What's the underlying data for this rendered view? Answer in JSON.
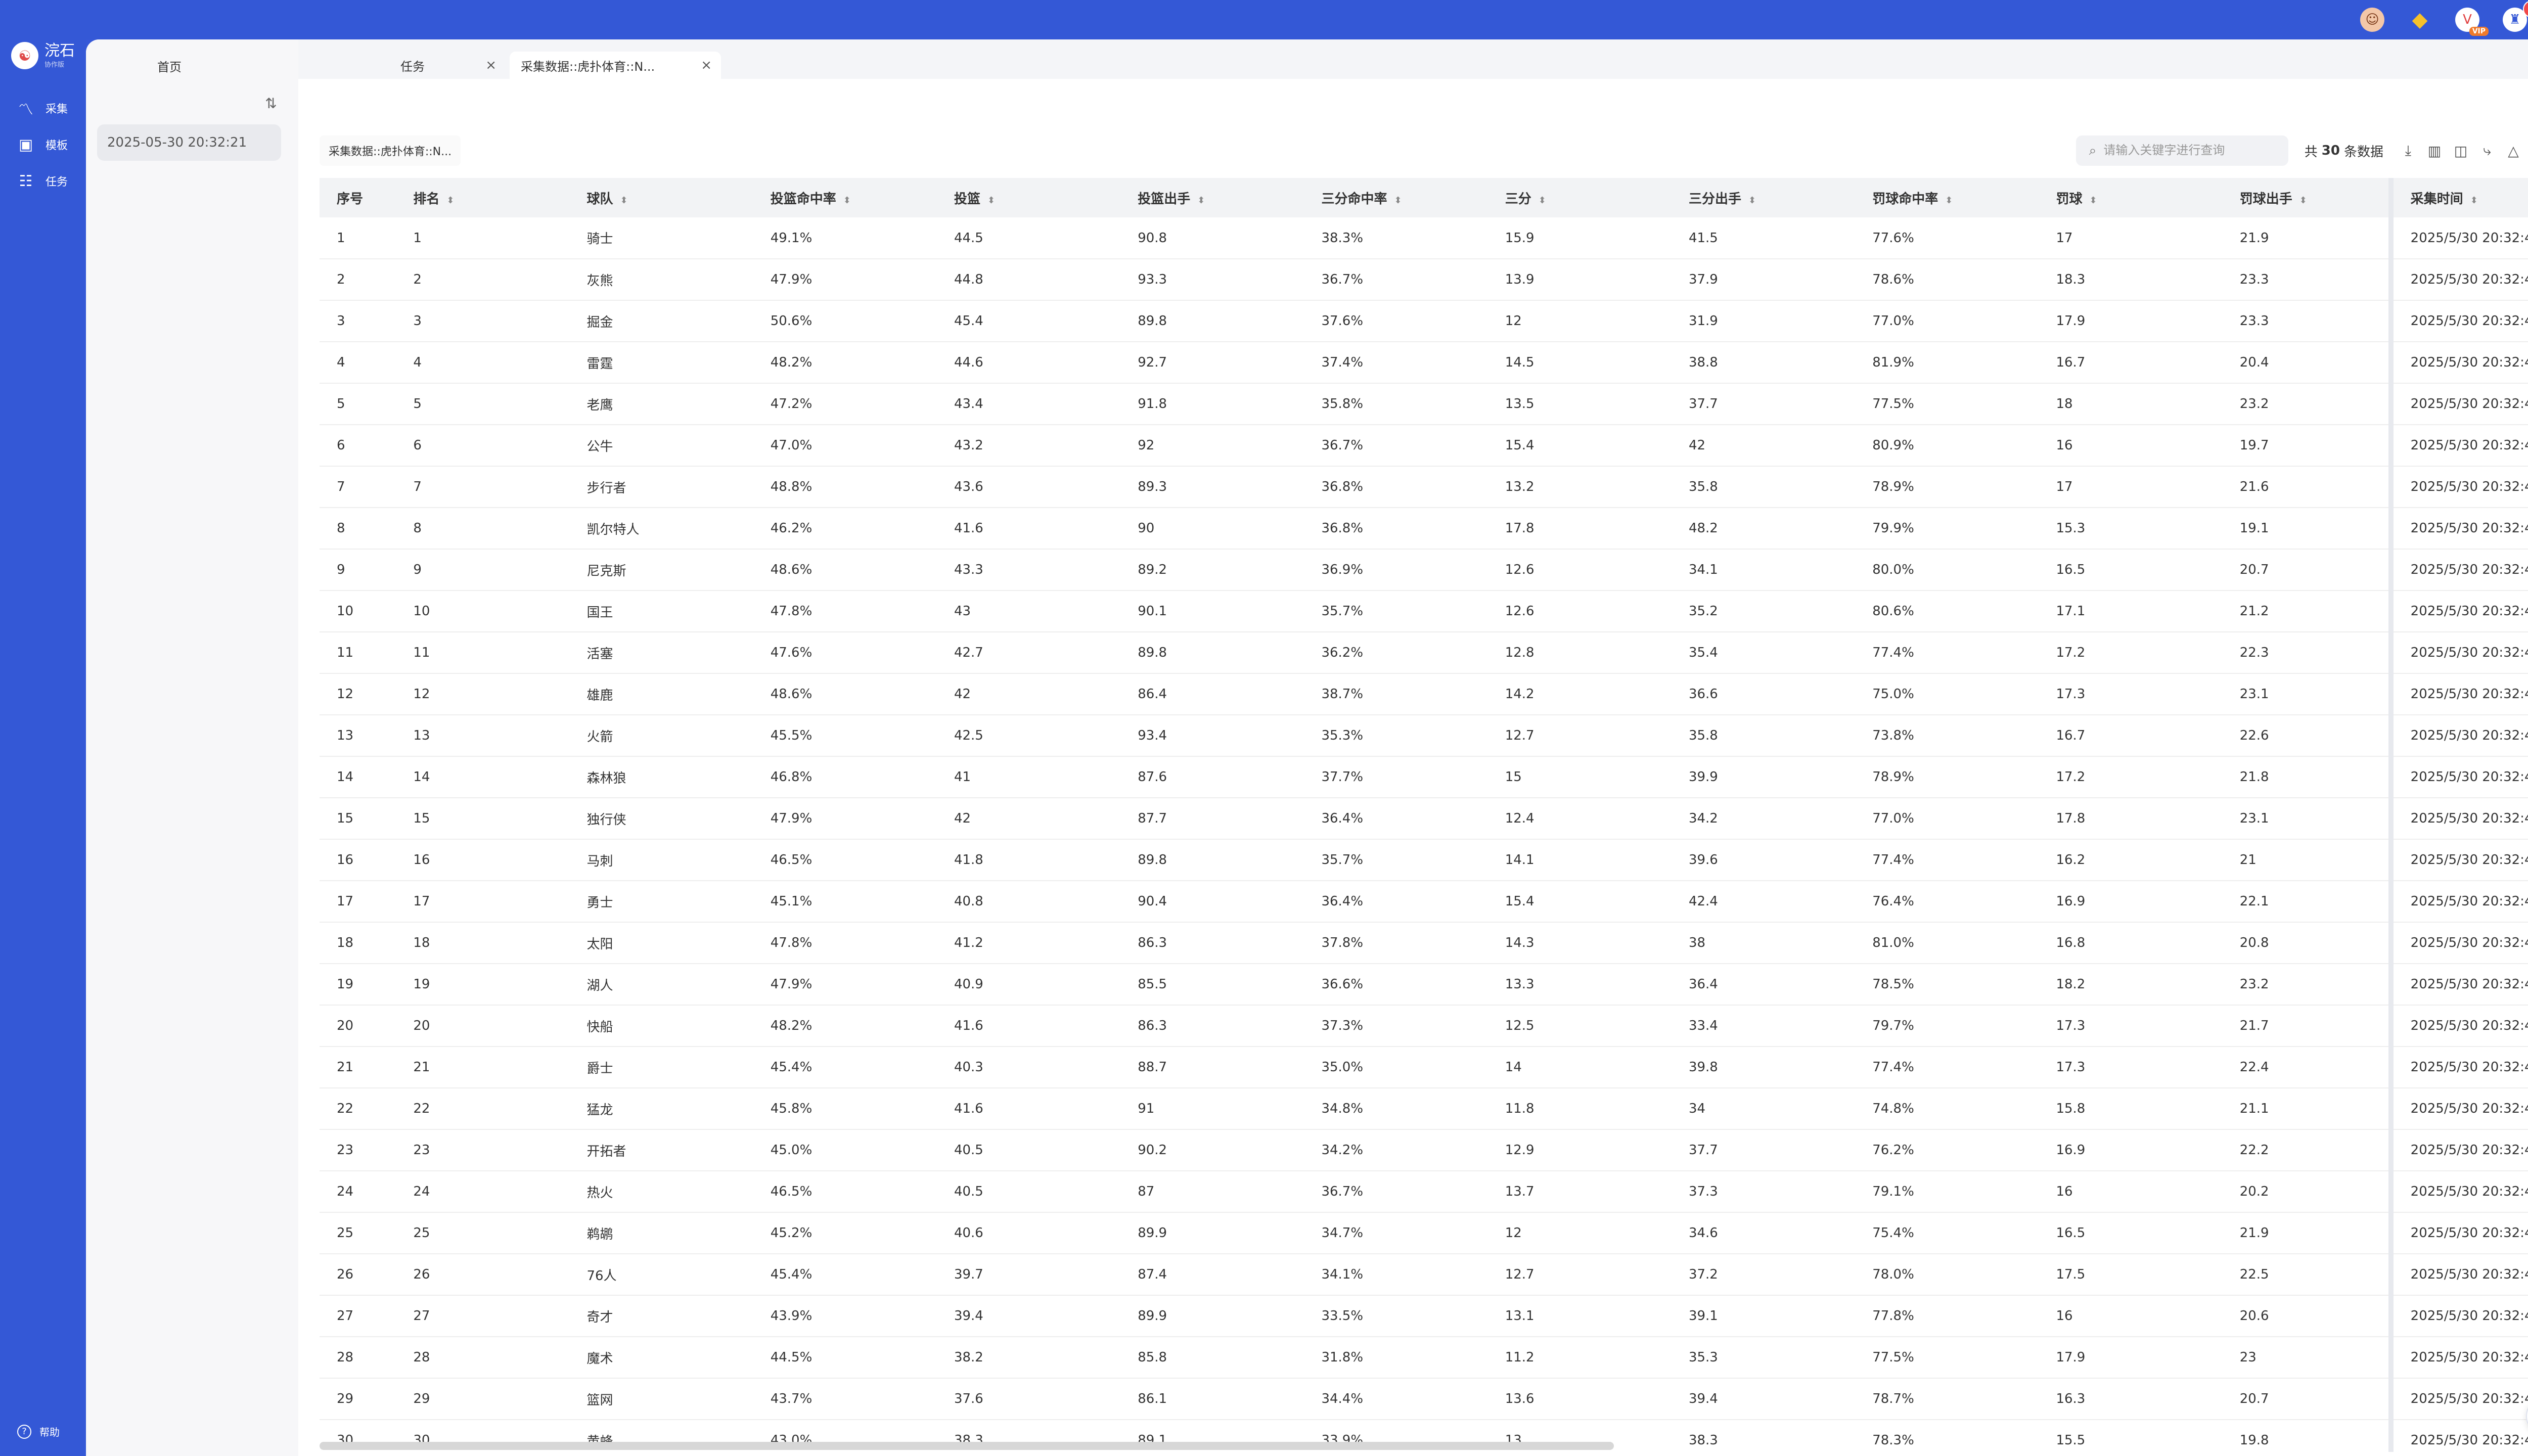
{
  "brand": {
    "name": "浣石",
    "sub": "协作版",
    "logo_icon": "☯"
  },
  "top_icons": [
    {
      "name": "user-avatar-icon",
      "symbol": "☺",
      "badge": ""
    },
    {
      "name": "diamond-icon",
      "symbol": "◆",
      "badge": ""
    },
    {
      "name": "vip-icon",
      "symbol": "V",
      "badge": "VIP"
    },
    {
      "name": "notification-icon",
      "symbol": "♜",
      "badge": "1"
    },
    {
      "name": "settings-icon",
      "symbol": "⚙",
      "badge": ""
    }
  ],
  "nav": [
    {
      "key": "collect",
      "label": "采集",
      "icon": "chart-line-icon",
      "symbol": "〽"
    },
    {
      "key": "templates",
      "label": "模板",
      "icon": "template-icon",
      "symbol": "▣"
    },
    {
      "key": "tasks",
      "label": "任务",
      "icon": "task-icon",
      "symbol": "☷"
    }
  ],
  "help": {
    "label": "帮助",
    "symbol": "?"
  },
  "home_tab": "首页",
  "tabs": [
    {
      "label": "任务",
      "close": "×"
    },
    {
      "label": "采集数据::虎扑体育::N...",
      "close": "×"
    }
  ],
  "panel": {
    "sort_icon": "⇅",
    "date": "2025-05-30 20:32:21"
  },
  "view_chip": "采集数据::虎扑体育::N...",
  "search": {
    "placeholder": "请输入关键字进行查询",
    "icon": "⌕"
  },
  "total": {
    "prefix": "共",
    "count": "30",
    "suffix": "条数据"
  },
  "toolbar_icons": [
    {
      "name": "download-icon",
      "symbol": "⤓"
    },
    {
      "name": "bar-chart-icon",
      "symbol": "▥"
    },
    {
      "name": "image-icon",
      "symbol": "◫"
    },
    {
      "name": "share-icon",
      "symbol": "⤷"
    },
    {
      "name": "warning-icon",
      "symbol": "△"
    },
    {
      "name": "save-icon",
      "symbol": "⛶"
    },
    {
      "name": "zoom-icon",
      "symbol": "⌕"
    }
  ],
  "table": {
    "columns": [
      "序号",
      "排名",
      "球队",
      "投篮命中率",
      "投篮",
      "投篮出手",
      "三分命中率",
      "三分",
      "三分出手",
      "罚球命中率",
      "罚球",
      "罚球出手",
      "采集时间"
    ],
    "rows": [
      [
        "1",
        "1",
        "骑士",
        "49.1%",
        "44.5",
        "90.8",
        "38.3%",
        "15.9",
        "41.5",
        "77.6%",
        "17",
        "21.9",
        "2025/5/30 20:32:44"
      ],
      [
        "2",
        "2",
        "灰熊",
        "47.9%",
        "44.8",
        "93.3",
        "36.7%",
        "13.9",
        "37.9",
        "78.6%",
        "18.3",
        "23.3",
        "2025/5/30 20:32:44"
      ],
      [
        "3",
        "3",
        "掘金",
        "50.6%",
        "45.4",
        "89.8",
        "37.6%",
        "12",
        "31.9",
        "77.0%",
        "17.9",
        "23.3",
        "2025/5/30 20:32:44"
      ],
      [
        "4",
        "4",
        "雷霆",
        "48.2%",
        "44.6",
        "92.7",
        "37.4%",
        "14.5",
        "38.8",
        "81.9%",
        "16.7",
        "20.4",
        "2025/5/30 20:32:44"
      ],
      [
        "5",
        "5",
        "老鹰",
        "47.2%",
        "43.4",
        "91.8",
        "35.8%",
        "13.5",
        "37.7",
        "77.5%",
        "18",
        "23.2",
        "2025/5/30 20:32:44"
      ],
      [
        "6",
        "6",
        "公牛",
        "47.0%",
        "43.2",
        "92",
        "36.7%",
        "15.4",
        "42",
        "80.9%",
        "16",
        "19.7",
        "2025/5/30 20:32:44"
      ],
      [
        "7",
        "7",
        "步行者",
        "48.8%",
        "43.6",
        "89.3",
        "36.8%",
        "13.2",
        "35.8",
        "78.9%",
        "17",
        "21.6",
        "2025/5/30 20:32:44"
      ],
      [
        "8",
        "8",
        "凯尔特人",
        "46.2%",
        "41.6",
        "90",
        "36.8%",
        "17.8",
        "48.2",
        "79.9%",
        "15.3",
        "19.1",
        "2025/5/30 20:32:44"
      ],
      [
        "9",
        "9",
        "尼克斯",
        "48.6%",
        "43.3",
        "89.2",
        "36.9%",
        "12.6",
        "34.1",
        "80.0%",
        "16.5",
        "20.7",
        "2025/5/30 20:32:44"
      ],
      [
        "10",
        "10",
        "国王",
        "47.8%",
        "43",
        "90.1",
        "35.7%",
        "12.6",
        "35.2",
        "80.6%",
        "17.1",
        "21.2",
        "2025/5/30 20:32:44"
      ],
      [
        "11",
        "11",
        "活塞",
        "47.6%",
        "42.7",
        "89.8",
        "36.2%",
        "12.8",
        "35.4",
        "77.4%",
        "17.2",
        "22.3",
        "2025/5/30 20:32:44"
      ],
      [
        "12",
        "12",
        "雄鹿",
        "48.6%",
        "42",
        "86.4",
        "38.7%",
        "14.2",
        "36.6",
        "75.0%",
        "17.3",
        "23.1",
        "2025/5/30 20:32:44"
      ],
      [
        "13",
        "13",
        "火箭",
        "45.5%",
        "42.5",
        "93.4",
        "35.3%",
        "12.7",
        "35.8",
        "73.8%",
        "16.7",
        "22.6",
        "2025/5/30 20:32:44"
      ],
      [
        "14",
        "14",
        "森林狼",
        "46.8%",
        "41",
        "87.6",
        "37.7%",
        "15",
        "39.9",
        "78.9%",
        "17.2",
        "21.8",
        "2025/5/30 20:32:44"
      ],
      [
        "15",
        "15",
        "独行侠",
        "47.9%",
        "42",
        "87.7",
        "36.4%",
        "12.4",
        "34.2",
        "77.0%",
        "17.8",
        "23.1",
        "2025/5/30 20:32:44"
      ],
      [
        "16",
        "16",
        "马刺",
        "46.5%",
        "41.8",
        "89.8",
        "35.7%",
        "14.1",
        "39.6",
        "77.4%",
        "16.2",
        "21",
        "2025/5/30 20:32:44"
      ],
      [
        "17",
        "17",
        "勇士",
        "45.1%",
        "40.8",
        "90.4",
        "36.4%",
        "15.4",
        "42.4",
        "76.4%",
        "16.9",
        "22.1",
        "2025/5/30 20:32:44"
      ],
      [
        "18",
        "18",
        "太阳",
        "47.8%",
        "41.2",
        "86.3",
        "37.8%",
        "14.3",
        "38",
        "81.0%",
        "16.8",
        "20.8",
        "2025/5/30 20:32:44"
      ],
      [
        "19",
        "19",
        "湖人",
        "47.9%",
        "40.9",
        "85.5",
        "36.6%",
        "13.3",
        "36.4",
        "78.5%",
        "18.2",
        "23.2",
        "2025/5/30 20:32:44"
      ],
      [
        "20",
        "20",
        "快船",
        "48.2%",
        "41.6",
        "86.3",
        "37.3%",
        "12.5",
        "33.4",
        "79.7%",
        "17.3",
        "21.7",
        "2025/5/30 20:32:44"
      ],
      [
        "21",
        "21",
        "爵士",
        "45.4%",
        "40.3",
        "88.7",
        "35.0%",
        "14",
        "39.8",
        "77.4%",
        "17.3",
        "22.4",
        "2025/5/30 20:32:44"
      ],
      [
        "22",
        "22",
        "猛龙",
        "45.8%",
        "41.6",
        "91",
        "34.8%",
        "11.8",
        "34",
        "74.8%",
        "15.8",
        "21.1",
        "2025/5/30 20:32:44"
      ],
      [
        "23",
        "23",
        "开拓者",
        "45.0%",
        "40.5",
        "90.2",
        "34.2%",
        "12.9",
        "37.7",
        "76.2%",
        "16.9",
        "22.2",
        "2025/5/30 20:32:44"
      ],
      [
        "24",
        "24",
        "热火",
        "46.5%",
        "40.5",
        "87",
        "36.7%",
        "13.7",
        "37.3",
        "79.1%",
        "16",
        "20.2",
        "2025/5/30 20:32:44"
      ],
      [
        "25",
        "25",
        "鹈鹕",
        "45.2%",
        "40.6",
        "89.9",
        "34.7%",
        "12",
        "34.6",
        "75.4%",
        "16.5",
        "21.9",
        "2025/5/30 20:32:44"
      ],
      [
        "26",
        "26",
        "76人",
        "45.4%",
        "39.7",
        "87.4",
        "34.1%",
        "12.7",
        "37.2",
        "78.0%",
        "17.5",
        "22.5",
        "2025/5/30 20:32:44"
      ],
      [
        "27",
        "27",
        "奇才",
        "43.9%",
        "39.4",
        "89.9",
        "33.5%",
        "13.1",
        "39.1",
        "77.8%",
        "16",
        "20.6",
        "2025/5/30 20:32:44"
      ],
      [
        "28",
        "28",
        "魔术",
        "44.5%",
        "38.2",
        "85.8",
        "31.8%",
        "11.2",
        "35.3",
        "77.5%",
        "17.9",
        "23",
        "2025/5/30 20:32:44"
      ],
      [
        "29",
        "29",
        "篮网",
        "43.7%",
        "37.6",
        "86.1",
        "34.4%",
        "13.6",
        "39.4",
        "78.7%",
        "16.3",
        "20.7",
        "2025/5/30 20:32:44"
      ],
      [
        "30",
        "30",
        "黄蜂",
        "43.0%",
        "38.3",
        "89.1",
        "33.9%",
        "13",
        "38.3",
        "78.3%",
        "15.5",
        "19.8",
        "2025/5/30 20:32:44"
      ]
    ]
  },
  "fab_icon": "⟲",
  "colors": {
    "primary": "#3458d6",
    "workspace": "#f4f5f8",
    "table_header": "#f2f3f5"
  }
}
